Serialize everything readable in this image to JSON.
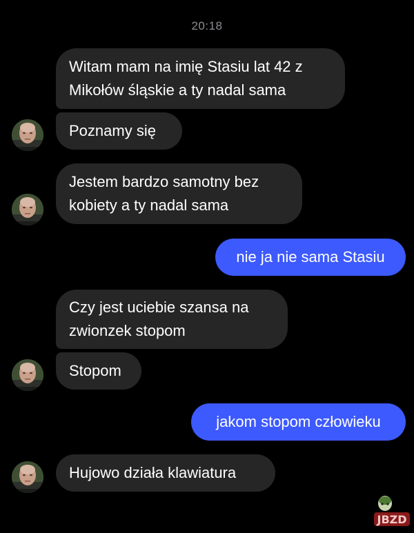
{
  "timestamp": "20:18",
  "messages": [
    {
      "direction": "incoming",
      "lines": [
        "Witam mam na imię Stasiu lat 42 z",
        "Mikołów śląskie a ty nadal sama"
      ]
    },
    {
      "direction": "incoming",
      "lines": [
        "Poznamy się"
      ]
    },
    {
      "direction": "incoming",
      "lines": [
        "Jestem bardzo samotny bez",
        "kobiety a ty nadal sama"
      ]
    },
    {
      "direction": "outgoing",
      "lines": [
        "nie ja nie sama Stasiu"
      ]
    },
    {
      "direction": "incoming",
      "lines": [
        "Czy jest uciebie szansa na",
        "zwionzek stopom"
      ]
    },
    {
      "direction": "incoming",
      "lines": [
        "Stopom"
      ]
    },
    {
      "direction": "outgoing",
      "lines": [
        "jakom stopom człowieku"
      ]
    },
    {
      "direction": "incoming",
      "lines": [
        "Hujowo działa klawiatura"
      ]
    }
  ],
  "watermark": {
    "text": "JBZD"
  },
  "colors": {
    "background": "#000000",
    "incoming_bubble": "#262626",
    "outgoing_bubble": "#3d5afe",
    "timestamp_text": "#8e8e93"
  }
}
